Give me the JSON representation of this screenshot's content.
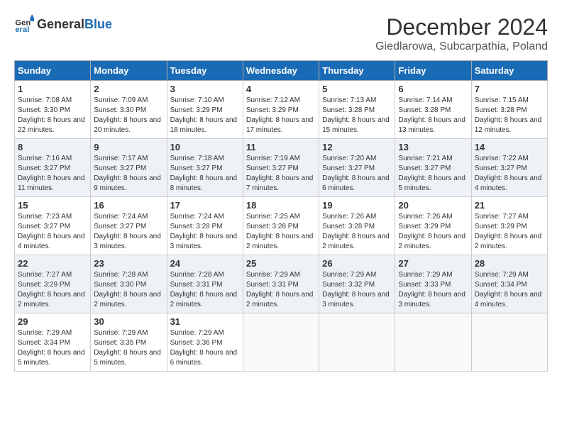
{
  "header": {
    "logo_general": "General",
    "logo_blue": "Blue",
    "month_title": "December 2024",
    "location": "Giedlarowa, Subcarpathia, Poland"
  },
  "columns": [
    "Sunday",
    "Monday",
    "Tuesday",
    "Wednesday",
    "Thursday",
    "Friday",
    "Saturday"
  ],
  "weeks": [
    [
      {
        "day": "1",
        "sunrise": "7:08 AM",
        "sunset": "3:30 PM",
        "daylight": "8 hours and 22 minutes."
      },
      {
        "day": "2",
        "sunrise": "7:09 AM",
        "sunset": "3:30 PM",
        "daylight": "8 hours and 20 minutes."
      },
      {
        "day": "3",
        "sunrise": "7:10 AM",
        "sunset": "3:29 PM",
        "daylight": "8 hours and 18 minutes."
      },
      {
        "day": "4",
        "sunrise": "7:12 AM",
        "sunset": "3:29 PM",
        "daylight": "8 hours and 17 minutes."
      },
      {
        "day": "5",
        "sunrise": "7:13 AM",
        "sunset": "3:28 PM",
        "daylight": "8 hours and 15 minutes."
      },
      {
        "day": "6",
        "sunrise": "7:14 AM",
        "sunset": "3:28 PM",
        "daylight": "8 hours and 13 minutes."
      },
      {
        "day": "7",
        "sunrise": "7:15 AM",
        "sunset": "3:28 PM",
        "daylight": "8 hours and 12 minutes."
      }
    ],
    [
      {
        "day": "8",
        "sunrise": "7:16 AM",
        "sunset": "3:27 PM",
        "daylight": "8 hours and 11 minutes."
      },
      {
        "day": "9",
        "sunrise": "7:17 AM",
        "sunset": "3:27 PM",
        "daylight": "8 hours and 9 minutes."
      },
      {
        "day": "10",
        "sunrise": "7:18 AM",
        "sunset": "3:27 PM",
        "daylight": "8 hours and 8 minutes."
      },
      {
        "day": "11",
        "sunrise": "7:19 AM",
        "sunset": "3:27 PM",
        "daylight": "8 hours and 7 minutes."
      },
      {
        "day": "12",
        "sunrise": "7:20 AM",
        "sunset": "3:27 PM",
        "daylight": "8 hours and 6 minutes."
      },
      {
        "day": "13",
        "sunrise": "7:21 AM",
        "sunset": "3:27 PM",
        "daylight": "8 hours and 5 minutes."
      },
      {
        "day": "14",
        "sunrise": "7:22 AM",
        "sunset": "3:27 PM",
        "daylight": "8 hours and 4 minutes."
      }
    ],
    [
      {
        "day": "15",
        "sunrise": "7:23 AM",
        "sunset": "3:27 PM",
        "daylight": "8 hours and 4 minutes."
      },
      {
        "day": "16",
        "sunrise": "7:24 AM",
        "sunset": "3:27 PM",
        "daylight": "8 hours and 3 minutes."
      },
      {
        "day": "17",
        "sunrise": "7:24 AM",
        "sunset": "3:28 PM",
        "daylight": "8 hours and 3 minutes."
      },
      {
        "day": "18",
        "sunrise": "7:25 AM",
        "sunset": "3:28 PM",
        "daylight": "8 hours and 2 minutes."
      },
      {
        "day": "19",
        "sunrise": "7:26 AM",
        "sunset": "3:28 PM",
        "daylight": "8 hours and 2 minutes."
      },
      {
        "day": "20",
        "sunrise": "7:26 AM",
        "sunset": "3:29 PM",
        "daylight": "8 hours and 2 minutes."
      },
      {
        "day": "21",
        "sunrise": "7:27 AM",
        "sunset": "3:29 PM",
        "daylight": "8 hours and 2 minutes."
      }
    ],
    [
      {
        "day": "22",
        "sunrise": "7:27 AM",
        "sunset": "3:29 PM",
        "daylight": "8 hours and 2 minutes."
      },
      {
        "day": "23",
        "sunrise": "7:28 AM",
        "sunset": "3:30 PM",
        "daylight": "8 hours and 2 minutes."
      },
      {
        "day": "24",
        "sunrise": "7:28 AM",
        "sunset": "3:31 PM",
        "daylight": "8 hours and 2 minutes."
      },
      {
        "day": "25",
        "sunrise": "7:29 AM",
        "sunset": "3:31 PM",
        "daylight": "8 hours and 2 minutes."
      },
      {
        "day": "26",
        "sunrise": "7:29 AM",
        "sunset": "3:32 PM",
        "daylight": "8 hours and 3 minutes."
      },
      {
        "day": "27",
        "sunrise": "7:29 AM",
        "sunset": "3:33 PM",
        "daylight": "8 hours and 3 minutes."
      },
      {
        "day": "28",
        "sunrise": "7:29 AM",
        "sunset": "3:34 PM",
        "daylight": "8 hours and 4 minutes."
      }
    ],
    [
      {
        "day": "29",
        "sunrise": "7:29 AM",
        "sunset": "3:34 PM",
        "daylight": "8 hours and 5 minutes."
      },
      {
        "day": "30",
        "sunrise": "7:29 AM",
        "sunset": "3:35 PM",
        "daylight": "8 hours and 5 minutes."
      },
      {
        "day": "31",
        "sunrise": "7:29 AM",
        "sunset": "3:36 PM",
        "daylight": "8 hours and 6 minutes."
      },
      null,
      null,
      null,
      null
    ]
  ]
}
